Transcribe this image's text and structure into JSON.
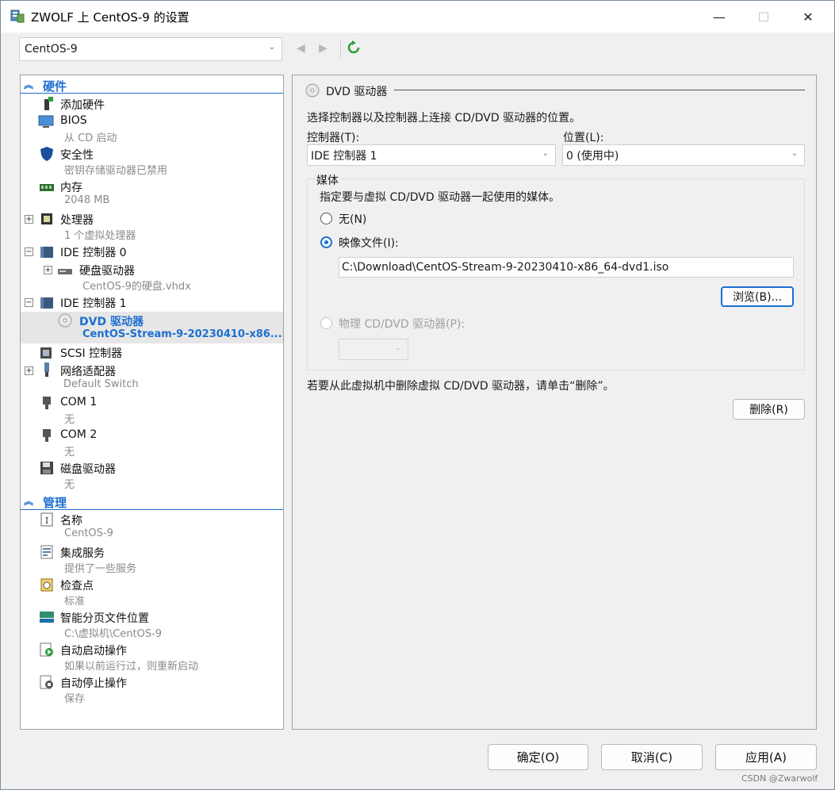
{
  "window": {
    "title": "ZWOLF 上 CentOS-9 的设置",
    "minimize": "—",
    "maximize": "☐",
    "close": "✕"
  },
  "toolbar": {
    "vm_selected": "CentOS-9",
    "back": "◀",
    "forward": "▶"
  },
  "tree": {
    "hardware_header": "硬件",
    "management_header": "管理",
    "nodes": [
      {
        "t1": "添加硬件",
        "t2": ""
      },
      {
        "t1": "BIOS",
        "t2": "从 CD 启动"
      },
      {
        "t1": "安全性",
        "t2": "密钥存储驱动器已禁用"
      },
      {
        "t1": "内存",
        "t2": "2048 MB"
      },
      {
        "t1": "处理器",
        "t2": "1 个虚拟处理器"
      },
      {
        "t1": "IDE 控制器 0",
        "t2": ""
      },
      {
        "t1": "硬盘驱动器",
        "t2": "CentOS-9的硬盘.vhdx"
      },
      {
        "t1": "IDE 控制器 1",
        "t2": ""
      },
      {
        "t1": "DVD 驱动器",
        "t2": "CentOS-Stream-9-20230410-x86..."
      },
      {
        "t1": "SCSI 控制器",
        "t2": ""
      },
      {
        "t1": "网络适配器",
        "t2": "Default Switch"
      },
      {
        "t1": "COM 1",
        "t2": "无"
      },
      {
        "t1": "COM 2",
        "t2": "无"
      },
      {
        "t1": "磁盘驱动器",
        "t2": "无"
      },
      {
        "t1": "名称",
        "t2": "CentOS-9"
      },
      {
        "t1": "集成服务",
        "t2": "提供了一些服务"
      },
      {
        "t1": "检查点",
        "t2": "标准"
      },
      {
        "t1": "智能分页文件位置",
        "t2": "C:\\虚拟机\\CentOS-9"
      },
      {
        "t1": "自动启动操作",
        "t2": "如果以前运行过，则重新启动"
      },
      {
        "t1": "自动停止操作",
        "t2": "保存"
      }
    ]
  },
  "detail": {
    "heading": "DVD 驱动器",
    "description": "选择控制器以及控制器上连接 CD/DVD 驱动器的位置。",
    "controller_label": "控制器(T):",
    "controller_value": "IDE 控制器 1",
    "location_label": "位置(L):",
    "location_value": "0 (使用中)",
    "media_title": "媒体",
    "media_description": "指定要与虚拟 CD/DVD 驱动器一起使用的媒体。",
    "option_none": "无(N)",
    "option_image": "映像文件(I):",
    "image_path": "C:\\Download\\CentOS-Stream-9-20230410-x86_64-dvd1.iso",
    "browse_button": "浏览(B)...",
    "option_physical": "物理 CD/DVD 驱动器(P):",
    "remove_description": "若要从此虚拟机中删除虚拟 CD/DVD 驱动器，请单击“删除”。",
    "remove_button": "删除(R)"
  },
  "footer": {
    "ok": "确定(O)",
    "cancel": "取消(C)",
    "apply": "应用(A)"
  },
  "watermark": "CSDN @Zwarwolf"
}
